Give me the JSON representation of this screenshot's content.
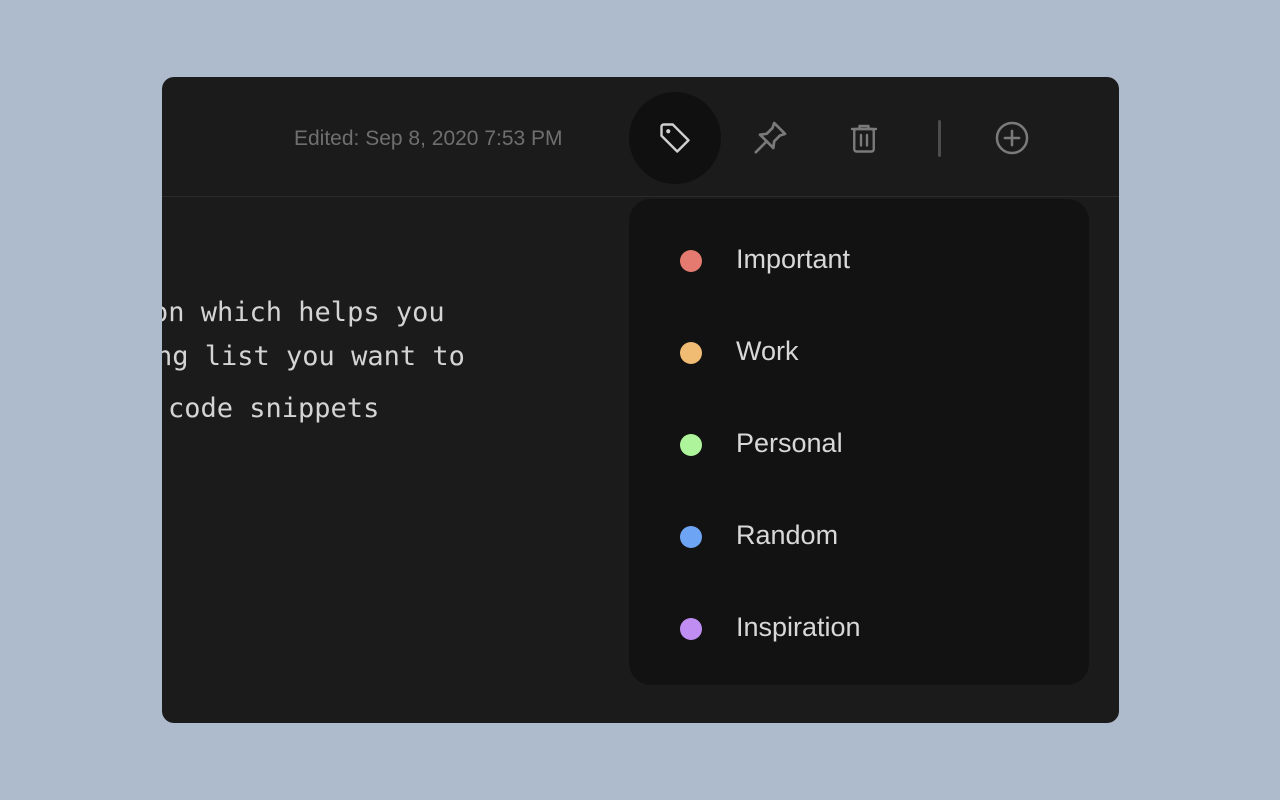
{
  "header": {
    "edited_text": "Edited: Sep 8, 2020 7:53 PM",
    "toolbar": [
      {
        "name": "tag",
        "icon": "tag-icon",
        "active": true
      },
      {
        "name": "pin",
        "icon": "pin-icon",
        "active": false
      },
      {
        "name": "trash",
        "icon": "trash-icon",
        "active": false
      },
      {
        "name": "add",
        "icon": "plus-circle-icon",
        "active": false
      }
    ]
  },
  "note": {
    "lines": [
      "on which helps you",
      "ng list you want to",
      "code snippets"
    ]
  },
  "tags": [
    {
      "label": "Important",
      "color": "#e57b70"
    },
    {
      "label": "Work",
      "color": "#f0bb72"
    },
    {
      "label": "Personal",
      "color": "#aef49a"
    },
    {
      "label": "Random",
      "color": "#6ea4f4"
    },
    {
      "label": "Inspiration",
      "color": "#c08ef2"
    }
  ]
}
